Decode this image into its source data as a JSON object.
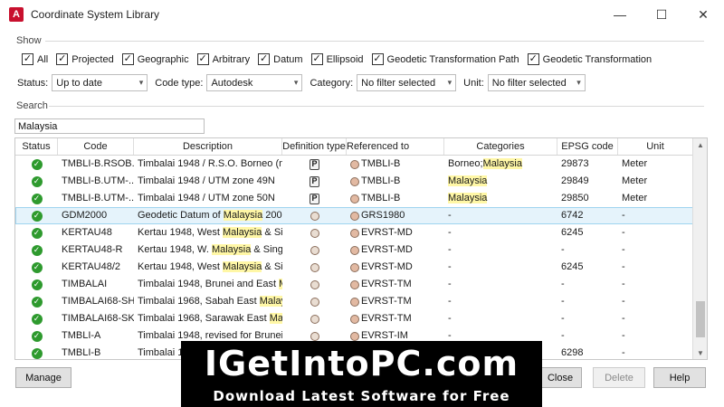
{
  "window": {
    "title": "Coordinate System Library",
    "app_icon": "A",
    "minimize": "—",
    "maximize": "☐",
    "close": "✕"
  },
  "show": {
    "label": "Show",
    "filters": [
      {
        "label": "All",
        "checked": true
      },
      {
        "label": "Projected",
        "checked": true
      },
      {
        "label": "Geographic",
        "checked": true
      },
      {
        "label": "Arbitrary",
        "checked": true
      },
      {
        "label": "Datum",
        "checked": true
      },
      {
        "label": "Ellipsoid",
        "checked": true
      },
      {
        "label": "Geodetic Transformation Path",
        "checked": true
      },
      {
        "label": "Geodetic Transformation",
        "checked": true
      }
    ]
  },
  "filter_row": {
    "status_label": "Status:",
    "status_value": "Up to date",
    "code_type_label": "Code type:",
    "code_type_value": "Autodesk",
    "category_label": "Category:",
    "category_value": "No filter selected",
    "unit_label": "Unit:",
    "unit_value": "No filter selected"
  },
  "search": {
    "label": "Search",
    "value": "Malaysia"
  },
  "table": {
    "columns": [
      "Status",
      "Code",
      "Description",
      "Definition type",
      "Referenced to",
      "Categories",
      "EPSG code",
      "Unit"
    ],
    "rows": [
      {
        "code": "TMBLI-B.RSOB...",
        "desc": [
          "Timbalai 1948 / R.S.O. Borneo (m)"
        ],
        "def": "P",
        "ref": "TMBLI-B",
        "cat": [
          "Borneo;",
          "Malaysia"
        ],
        "epsg": "29873",
        "unit": "Meter"
      },
      {
        "code": "TMBLI-B.UTM-...",
        "desc": [
          "Timbalai 1948 / UTM zone 49N"
        ],
        "def": "P",
        "ref": "TMBLI-B",
        "cat": [
          "",
          "Malaysia"
        ],
        "epsg": "29849",
        "unit": "Meter"
      },
      {
        "code": "TMBLI-B.UTM-...",
        "desc": [
          "Timbalai 1948 / UTM zone 50N"
        ],
        "def": "P",
        "ref": "TMBLI-B",
        "cat": [
          "",
          "Malaysia"
        ],
        "epsg": "29850",
        "unit": "Meter"
      },
      {
        "code": "GDM2000",
        "desc": [
          "Geodetic Datum of ",
          "Malaysia",
          " 2000"
        ],
        "def": "G",
        "ref": "GRS1980",
        "cat": [
          "-"
        ],
        "epsg": "6742",
        "unit": "-",
        "selected": true
      },
      {
        "code": "KERTAU48",
        "desc": [
          "Kertau 1948, West ",
          "Malaysia",
          " & Sin..."
        ],
        "def": "G",
        "ref": "EVRST-MD",
        "cat": [
          "-"
        ],
        "epsg": "6245",
        "unit": "-"
      },
      {
        "code": "KERTAU48-R",
        "desc": [
          "Kertau 1948, W. ",
          "Malaysia",
          " & Singa..."
        ],
        "def": "G",
        "ref": "EVRST-MD",
        "cat": [
          "-"
        ],
        "epsg": "-",
        "unit": "-"
      },
      {
        "code": "KERTAU48/2",
        "desc": [
          "Kertau 1948, West ",
          "Malaysia",
          " & Sin..."
        ],
        "def": "G",
        "ref": "EVRST-MD",
        "cat": [
          "-"
        ],
        "epsg": "6245",
        "unit": "-"
      },
      {
        "code": "TIMBALAI",
        "desc": [
          "Timbalai 1948, Brunei and East ",
          "M..."
        ],
        "def": "G",
        "ref": "EVRST-TM",
        "cat": [
          "-"
        ],
        "epsg": "-",
        "unit": "-"
      },
      {
        "code": "TIMBALAI68-SH",
        "desc": [
          "Timbalai 1968, Sabah East ",
          "Malays..."
        ],
        "def": "G",
        "ref": "EVRST-TM",
        "cat": [
          "-"
        ],
        "epsg": "-",
        "unit": "-"
      },
      {
        "code": "TIMBALAI68-SK",
        "desc": [
          "Timbalai 1968, Sarawak East ",
          "Mala..."
        ],
        "def": "G",
        "ref": "EVRST-TM",
        "cat": [
          "-"
        ],
        "epsg": "-",
        "unit": "-"
      },
      {
        "code": "TMBLI-A",
        "desc": [
          "Timbalai 1948, revised for Brunei..."
        ],
        "def": "G",
        "ref": "EVRST-IM",
        "cat": [
          "-"
        ],
        "epsg": "-",
        "unit": "-"
      },
      {
        "code": "TMBLI-B",
        "desc": [
          "Timbalai 19..."
        ],
        "def": "G",
        "ref": "EVRST-TM",
        "cat": [
          "-"
        ],
        "epsg": "6298",
        "unit": "-"
      }
    ]
  },
  "buttons": {
    "manage": "Manage",
    "close": "Close",
    "delete": "Delete",
    "help": "Help"
  },
  "watermark": {
    "line1": "IGetIntoPC.com",
    "line2": "Download Latest Software for Free"
  },
  "colors": {
    "highlight": "#fff7a6",
    "selected_row": "#e5f3fb",
    "status_ok": "#2e9a2e",
    "app_icon": "#c8102e"
  }
}
